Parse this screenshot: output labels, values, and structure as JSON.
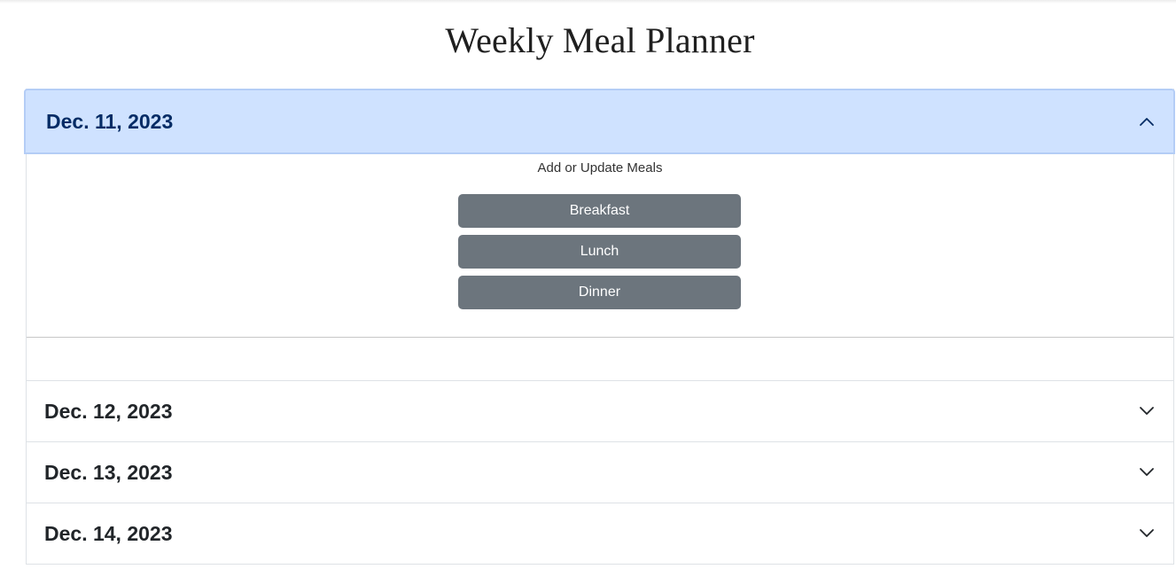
{
  "page": {
    "title": "Weekly Meal Planner"
  },
  "days": [
    {
      "date": "Dec. 11, 2023",
      "expanded": true,
      "body": {
        "caption": "Add or Update Meals",
        "buttons": [
          "Breakfast",
          "Lunch",
          "Dinner"
        ]
      }
    },
    {
      "date": "Dec. 12, 2023",
      "expanded": false
    },
    {
      "date": "Dec. 13, 2023",
      "expanded": false
    },
    {
      "date": "Dec. 14, 2023",
      "expanded": false
    }
  ],
  "colors": {
    "expanded_header_bg": "#cfe2ff",
    "expanded_header_text": "#052c65",
    "meal_button_bg": "#6c757d",
    "border": "#dee2e6"
  },
  "icons": {
    "expanded": "chevron-up-icon",
    "collapsed": "chevron-down-icon"
  }
}
